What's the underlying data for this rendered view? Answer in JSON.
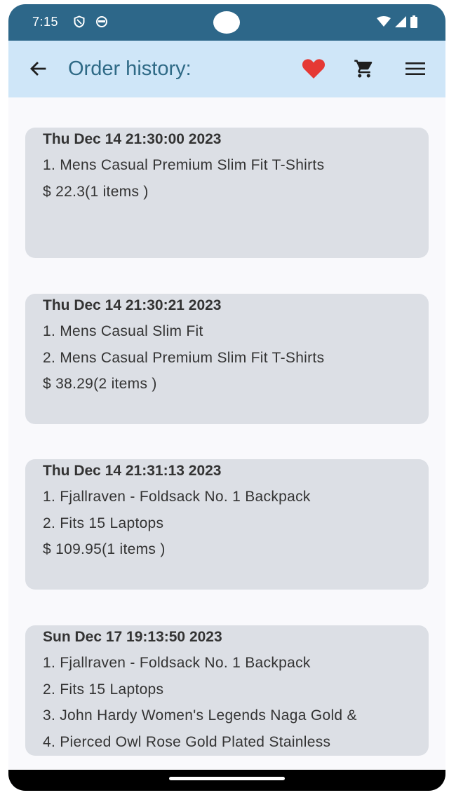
{
  "status_bar": {
    "time": "7:15",
    "icons": [
      "shield-icon",
      "sync-icon",
      "wifi-icon",
      "signal-icon",
      "battery-icon"
    ]
  },
  "app_bar": {
    "title": "Order history:",
    "icons": [
      "back-arrow-icon",
      "heart-icon",
      "cart-icon",
      "menu-icon"
    ],
    "colors": {
      "background": "#cfe6f8",
      "title": "#2f6a86",
      "heart": "#e53935"
    }
  },
  "orders": [
    {
      "date": "Thu Dec 14 21:30:00 2023",
      "items": [
        "1. Mens Casual Premium Slim Fit T-Shirts"
      ],
      "total": "$ 22.3(1 items )"
    },
    {
      "date": "Thu Dec 14 21:30:21 2023",
      "items": [
        "1. Mens Casual Slim Fit",
        "2. Mens Casual Premium Slim Fit T-Shirts"
      ],
      "total": "$ 38.29(2 items )"
    },
    {
      "date": "Thu Dec 14 21:31:13 2023",
      "items": [
        "1. Fjallraven - Foldsack No. 1 Backpack",
        "2. Fits 15 Laptops"
      ],
      "total": "$ 109.95(1 items )"
    },
    {
      "date": "Sun Dec 17 19:13:50 2023",
      "items": [
        "1. Fjallraven - Foldsack No. 1 Backpack",
        "2. Fits 15 Laptops",
        "3. John Hardy Women's Legends Naga Gold &",
        "4. Pierced Owl Rose Gold Plated Stainless"
      ],
      "total": ""
    }
  ]
}
